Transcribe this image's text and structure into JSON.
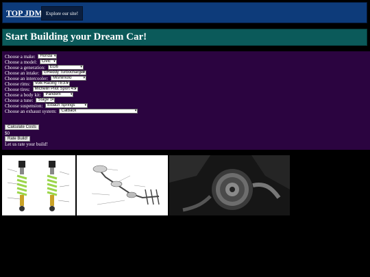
{
  "nav": {
    "brand": "TOP JDM",
    "explore_label": "Explore our site!"
  },
  "banner": {
    "title": "Start Building your Dream Car!"
  },
  "form": {
    "fields": [
      {
        "label": "Choose a make:",
        "value": "Honda"
      },
      {
        "label": "Choose a model:",
        "value": "Civic"
      },
      {
        "label": "Choose a generation:",
        "value": "EG6"
      },
      {
        "label": "Choose an intake:",
        "value": "GReddy Turbocharger"
      },
      {
        "label": "Choose an intercooler:",
        "value": "Mishimoto"
      },
      {
        "label": "Choose rims:",
        "value": "Volk Racing TE37"
      },
      {
        "label": "Choose tires:",
        "value": "Michelin Pilot Sport 4S"
      },
      {
        "label": "Choose a body kit:",
        "value": "Pandem"
      },
      {
        "label": "Choose a tune:",
        "value": "Stage 1"
      },
      {
        "label": "Choose suspension:",
        "value": "Eibach Springs"
      },
      {
        "label": "Choose an exhaust system:",
        "value": "Catback"
      }
    ],
    "calculate_label": "Calculate Costs",
    "cost_total": "$0",
    "rate_label": "Rate Build!",
    "rate_message": "Let us rate your build!"
  },
  "gallery": [
    {
      "name": "coilover-suspension-image"
    },
    {
      "name": "exhaust-system-diagram-image"
    },
    {
      "name": "turbocharger-photo-image"
    }
  ]
}
